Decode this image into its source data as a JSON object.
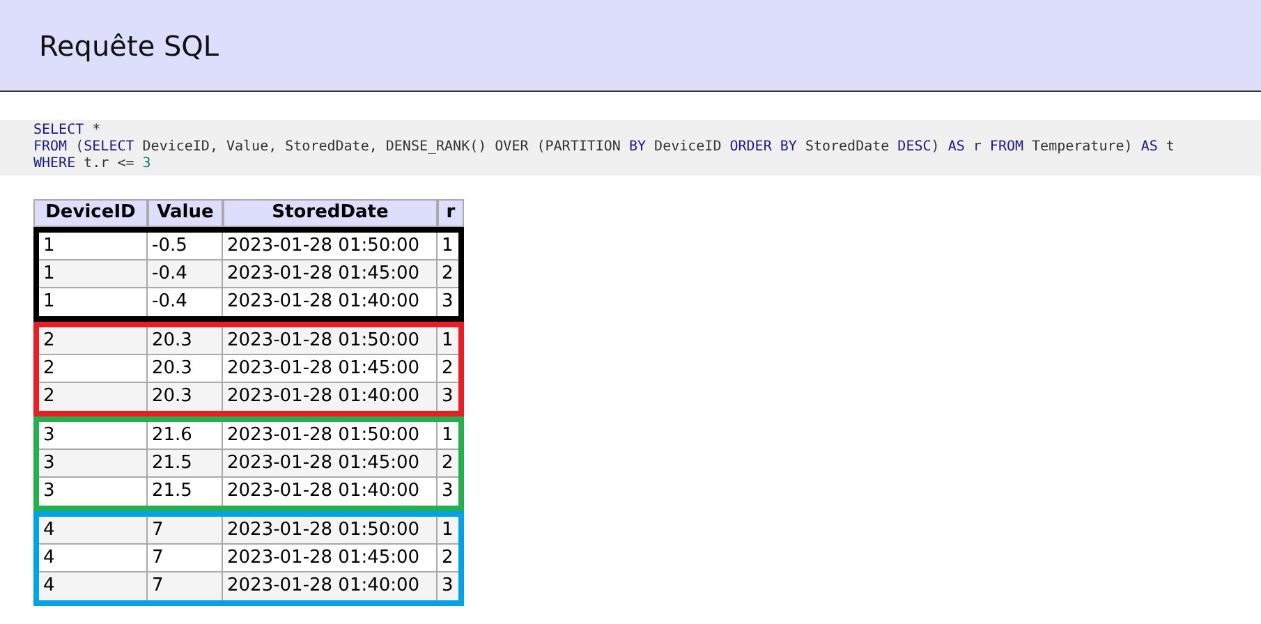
{
  "header": {
    "title": "Requête SQL"
  },
  "query": {
    "lines": [
      [
        {
          "kind": "keyword",
          "text": "SELECT"
        },
        {
          "kind": "plain",
          "text": " *"
        }
      ],
      [
        {
          "kind": "keyword",
          "text": "FROM"
        },
        {
          "kind": "plain",
          "text": " ("
        },
        {
          "kind": "keyword",
          "text": "SELECT"
        },
        {
          "kind": "plain",
          "text": " DeviceID, Value, StoredDate, DENSE_RANK() OVER (PARTITION "
        },
        {
          "kind": "keyword",
          "text": "BY"
        },
        {
          "kind": "plain",
          "text": " DeviceID "
        },
        {
          "kind": "keyword",
          "text": "ORDER BY"
        },
        {
          "kind": "plain",
          "text": " StoredDate "
        },
        {
          "kind": "keyword",
          "text": "DESC"
        },
        {
          "kind": "plain",
          "text": ") "
        },
        {
          "kind": "keyword",
          "text": "AS"
        },
        {
          "kind": "plain",
          "text": " r "
        },
        {
          "kind": "keyword",
          "text": "FROM"
        },
        {
          "kind": "plain",
          "text": " Temperature) "
        },
        {
          "kind": "keyword",
          "text": "AS"
        },
        {
          "kind": "plain",
          "text": " t"
        }
      ],
      [
        {
          "kind": "keyword",
          "text": "WHERE"
        },
        {
          "kind": "plain",
          "text": " t.r <= "
        },
        {
          "kind": "number",
          "text": "3"
        }
      ]
    ]
  },
  "table": {
    "columns": [
      "DeviceID",
      "Value",
      "StoredDate",
      "r"
    ],
    "groups": [
      {
        "color": "#000000",
        "rows": [
          [
            "1",
            "-0.5",
            "2023-01-28 01:50:00",
            "1"
          ],
          [
            "1",
            "-0.4",
            "2023-01-28 01:45:00",
            "2"
          ],
          [
            "1",
            "-0.4",
            "2023-01-28 01:40:00",
            "3"
          ]
        ]
      },
      {
        "color": "#ed1c24",
        "rows": [
          [
            "2",
            "20.3",
            "2023-01-28 01:50:00",
            "1"
          ],
          [
            "2",
            "20.3",
            "2023-01-28 01:45:00",
            "2"
          ],
          [
            "2",
            "20.3",
            "2023-01-28 01:40:00",
            "3"
          ]
        ]
      },
      {
        "color": "#22b14c",
        "rows": [
          [
            "3",
            "21.6",
            "2023-01-28 01:50:00",
            "1"
          ],
          [
            "3",
            "21.5",
            "2023-01-28 01:45:00",
            "2"
          ],
          [
            "3",
            "21.5",
            "2023-01-28 01:40:00",
            "3"
          ]
        ]
      },
      {
        "color": "#00a2e8",
        "rows": [
          [
            "4",
            "7",
            "2023-01-28 01:50:00",
            "1"
          ],
          [
            "4",
            "7",
            "2023-01-28 01:45:00",
            "2"
          ],
          [
            "4",
            "7",
            "2023-01-28 01:40:00",
            "3"
          ]
        ]
      }
    ]
  }
}
